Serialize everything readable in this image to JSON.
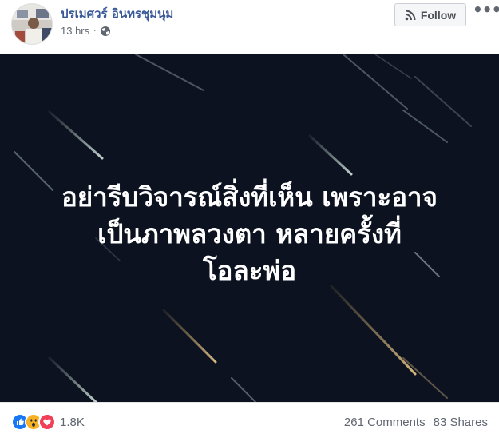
{
  "post": {
    "author_name": "ปรเมศวร์ อินทรชุมนุม",
    "timestamp": "13 hrs",
    "separator": "·",
    "privacy_icon": "globe-icon",
    "follow_label": "Follow",
    "follow_icon": "rss-icon",
    "more_icon": "more-options-icon",
    "more_glyph": "•••"
  },
  "photo": {
    "text_lines": [
      "อย่ารีบวิจารณ์สิ่งที่เห็น เพราะอาจ",
      "เป็นภาพลวงตา หลายครั้งที่",
      "โอละพ่อ"
    ],
    "background_color": "#0c1220"
  },
  "footer": {
    "reaction_icons": [
      "like-icon",
      "wow-icon",
      "love-icon"
    ],
    "reaction_count": "1.8K",
    "comments": "261 Comments",
    "shares": "83 Shares"
  },
  "colors": {
    "link": "#385898",
    "meta": "#616770",
    "like": "#1877f2",
    "love": "#f33e58",
    "wow": "#f7b125"
  }
}
